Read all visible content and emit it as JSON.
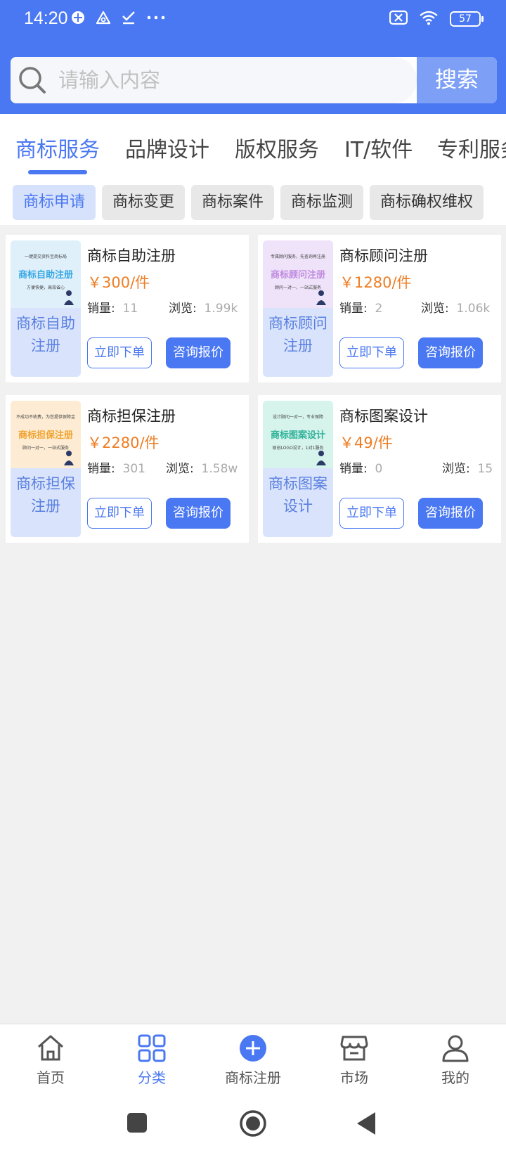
{
  "status": {
    "time": "14:20",
    "battery": "57"
  },
  "search": {
    "placeholder": "请输入内容",
    "button": "搜索"
  },
  "tabs": [
    {
      "label": "商标服务"
    },
    {
      "label": "品牌设计"
    },
    {
      "label": "版权服务"
    },
    {
      "label": "IT/软件"
    },
    {
      "label": "专利服务"
    }
  ],
  "chips": [
    {
      "label": "商标申请"
    },
    {
      "label": "商标变更"
    },
    {
      "label": "商标案件"
    },
    {
      "label": "商标监测"
    },
    {
      "label": "商标确权维权"
    }
  ],
  "products": [
    {
      "title": "商标自助注册",
      "price": "￥300/件",
      "sales_label": "销量:",
      "sales": "11",
      "views_label": "浏览:",
      "views": "1.99k",
      "thumb_top": "一键提交资料至商标局",
      "thumb_title": "商标自助注册",
      "thumb_bottom": "方便快捷，高效省心",
      "thumb_caption": "商标自助注册",
      "order_label": "立即下单",
      "quote_label": "咨询报价",
      "thumb_color": "#38a8e3",
      "thumb_bg": "#dff0fb"
    },
    {
      "title": "商标顾问注册",
      "price": "￥1280/件",
      "sales_label": "销量:",
      "sales": "2",
      "views_label": "浏览:",
      "views": "1.06k",
      "thumb_top": "专属顾问服务，先查询再注册",
      "thumb_title": "商标顾问注册",
      "thumb_bottom": "顾问一对一，一站式服务",
      "thumb_caption": "商标顾问注册",
      "order_label": "立即下单",
      "quote_label": "咨询报价",
      "thumb_color": "#c08be0",
      "thumb_bg": "#efe3fa"
    },
    {
      "title": "商标担保注册",
      "price": "￥2280/件",
      "sales_label": "销量:",
      "sales": "301",
      "views_label": "浏览:",
      "views": "1.58w",
      "thumb_top": "不成功不收费，为您提供保障金",
      "thumb_title": "商标担保注册",
      "thumb_bottom": "顾问一对一，一站式服务",
      "thumb_caption": "商标担保注册",
      "order_label": "立即下单",
      "quote_label": "咨询报价",
      "thumb_color": "#f0a431",
      "thumb_bg": "#fdecd3"
    },
    {
      "title": "商标图案设计",
      "price": "￥49/件",
      "sales_label": "销量:",
      "sales": "0",
      "views_label": "浏览:",
      "views": "15",
      "thumb_top": "设计顾问一对一，专业保障",
      "thumb_title": "商标图案设计",
      "thumb_bottom": "原创LOGO设计，1对1服务",
      "thumb_caption": "商标图案设计",
      "order_label": "立即下单",
      "quote_label": "咨询报价",
      "thumb_color": "#2fb29a",
      "thumb_bg": "#d6f3ec"
    }
  ],
  "nav": [
    {
      "label": "首页",
      "icon": "home-icon"
    },
    {
      "label": "分类",
      "icon": "grid-icon"
    },
    {
      "label": "商标注册",
      "icon": "plus-circle-icon"
    },
    {
      "label": "市场",
      "icon": "store-icon"
    },
    {
      "label": "我的",
      "icon": "user-icon"
    }
  ],
  "colors": {
    "primary": "#4a78f2",
    "price": "#ee7d23",
    "chip_active_bg": "#d6e1fb"
  }
}
